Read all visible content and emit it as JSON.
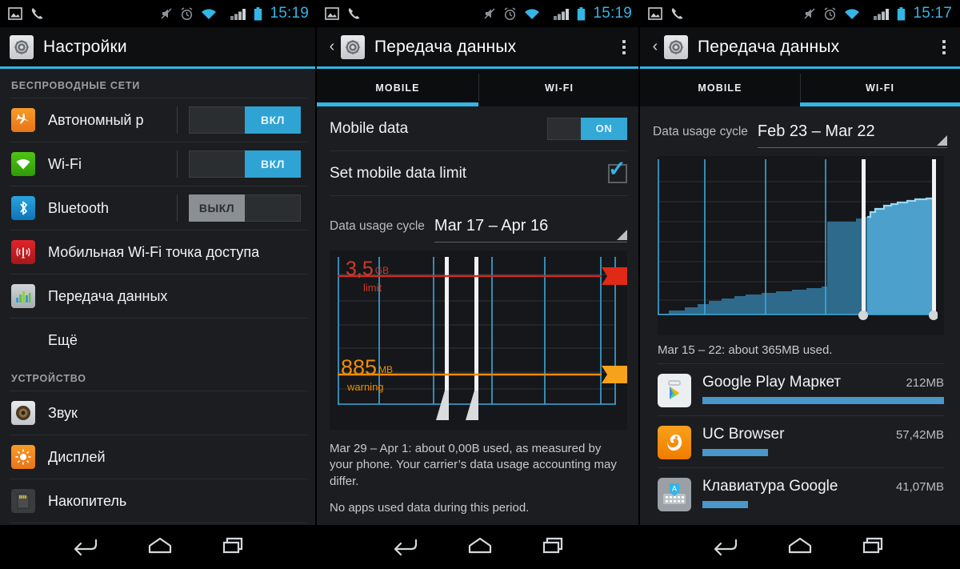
{
  "status_bar": {
    "time_left": "15:19",
    "time_mid": "15:19",
    "time_right": "15:17",
    "icons": [
      "image-icon",
      "phone-icon",
      "mute-icon",
      "alarm-icon",
      "wifi-icon",
      "signal-icon",
      "battery-icon"
    ]
  },
  "left_panel": {
    "title": "Настройки",
    "sections": [
      {
        "header": "БЕСПРОВОДНЫЕ СЕТИ",
        "items": [
          {
            "label": "Автономный р",
            "icon": "airplane-icon",
            "switch": "on",
            "switch_label": "ВКЛ"
          },
          {
            "label": "Wi-Fi",
            "icon": "wifi-green-icon",
            "switch": "on",
            "switch_label": "ВКЛ"
          },
          {
            "label": "Bluetooth",
            "icon": "bluetooth-icon",
            "switch": "off",
            "switch_label": "ВЫКЛ"
          },
          {
            "label": "Мобильная Wi-Fi точка доступа",
            "icon": "hotspot-icon",
            "switch": "none",
            "switch_label": ""
          },
          {
            "label": "Передача данных",
            "icon": "data-usage-icon",
            "switch": "none",
            "switch_label": ""
          },
          {
            "label": "Ещё",
            "icon": "none",
            "switch": "none",
            "switch_label": ""
          }
        ]
      },
      {
        "header": "УСТРОЙСТВО",
        "items": [
          {
            "label": "Звук",
            "icon": "sound-icon",
            "switch": "none",
            "switch_label": ""
          },
          {
            "label": "Дисплей",
            "icon": "display-icon",
            "switch": "none",
            "switch_label": ""
          },
          {
            "label": "Накопитель",
            "icon": "storage-icon",
            "switch": "none",
            "switch_label": ""
          }
        ]
      }
    ]
  },
  "mid_panel": {
    "title": "Передача данных",
    "tabs": [
      {
        "label": "MOBILE",
        "active": true
      },
      {
        "label": "WI-FI",
        "active": false
      }
    ],
    "mobile_data_label": "Mobile data",
    "mobile_data_toggle": "ON",
    "set_limit_label": "Set mobile data limit",
    "set_limit_checked": true,
    "cycle_label": "Data usage cycle",
    "cycle_value": "Mar 17 – Apr 16",
    "note_1": "Mar 29 – Apr 1: about 0,00B used, as measured by your phone. Your carrier’s data usage accounting may differ.",
    "note_2": "No apps used data during this period."
  },
  "right_panel": {
    "title": "Передача данных",
    "tabs": [
      {
        "label": "MOBILE",
        "active": false
      },
      {
        "label": "WI-FI",
        "active": true
      }
    ],
    "cycle_label": "Data usage cycle",
    "cycle_value": "Feb 23 – Mar 22",
    "usage_summary": "Mar 15 – 22: about 365MB used.",
    "apps": [
      {
        "name": "Google Play Маркет",
        "size": "212MB",
        "bar_pct": 100,
        "icon": "play-store-icon"
      },
      {
        "name": "UC Browser",
        "size": "57,42MB",
        "bar_pct": 27,
        "icon": "uc-browser-icon"
      },
      {
        "name": "Клавиатура Google",
        "size": "41,07MB",
        "bar_pct": 19,
        "icon": "gboard-icon"
      }
    ]
  },
  "nav_bar": {
    "buttons": [
      "back-icon",
      "home-icon",
      "recents-icon"
    ]
  },
  "colors": {
    "accent": "#33b5e5",
    "limit_red": "#cc2b20",
    "warning_orange": "#f39200",
    "chart_blue": "#4a9fcc",
    "panel_bg": "#1b1d20"
  },
  "chart_data": [
    {
      "id": "mobile-usage-chart",
      "type": "area",
      "title": "",
      "xlabel": "",
      "ylabel": "",
      "period": "Mar 17 – Apr 16",
      "limit_value": "3,5",
      "limit_unit": "GB",
      "limit_caption": "limit",
      "limit_frac": 0.88,
      "warning_value": "885",
      "warning_unit": "MB",
      "warning_caption": "warning",
      "warning_frac": 0.22,
      "grid_on": true,
      "vertical_gridlines_frac": [
        0.0,
        0.148,
        0.345,
        0.555,
        0.745,
        0.945,
        1.0
      ],
      "horizontal_gridlines_frac": [
        0.12,
        0.3,
        0.46,
        0.62,
        0.78,
        0.9
      ],
      "selection_handles_frac": [
        0.405,
        0.475
      ],
      "values": [
        0,
        0,
        0,
        0,
        0,
        0,
        0
      ],
      "categories": [
        "",
        "",
        "",
        "",
        "",
        "",
        ""
      ],
      "used_total": "0,00B"
    },
    {
      "id": "wifi-usage-chart",
      "type": "area",
      "title": "",
      "xlabel": "",
      "ylabel": "",
      "period": "Feb 23 – Mar 22",
      "grid_on": true,
      "vertical_gridlines_frac": [
        0.0,
        0.193,
        0.448,
        0.7,
        1.0
      ],
      "horizontal_gridlines_frac": [
        0.14,
        0.26,
        0.38,
        0.5,
        0.62,
        0.74,
        0.86
      ],
      "selection_handles_frac": [
        0.755,
        0.995
      ],
      "x": [
        0,
        0.04,
        0.08,
        0.12,
        0.16,
        0.2,
        0.24,
        0.28,
        0.32,
        0.36,
        0.4,
        0.44,
        0.48,
        0.52,
        0.56,
        0.6,
        0.64,
        0.665,
        0.7,
        0.74,
        0.755,
        0.79,
        0.83,
        0.86,
        0.9,
        0.94,
        0.97,
        1.0
      ],
      "values": [
        0.0,
        0.01,
        0.03,
        0.04,
        0.05,
        0.07,
        0.07,
        0.09,
        0.09,
        0.1,
        0.11,
        0.11,
        0.12,
        0.12,
        0.13,
        0.13,
        0.14,
        0.53,
        0.53,
        0.54,
        0.6,
        0.66,
        0.7,
        0.72,
        0.73,
        0.75,
        0.76,
        0.77
      ],
      "ylim": [
        0,
        1
      ],
      "used_total": "365MB"
    }
  ]
}
